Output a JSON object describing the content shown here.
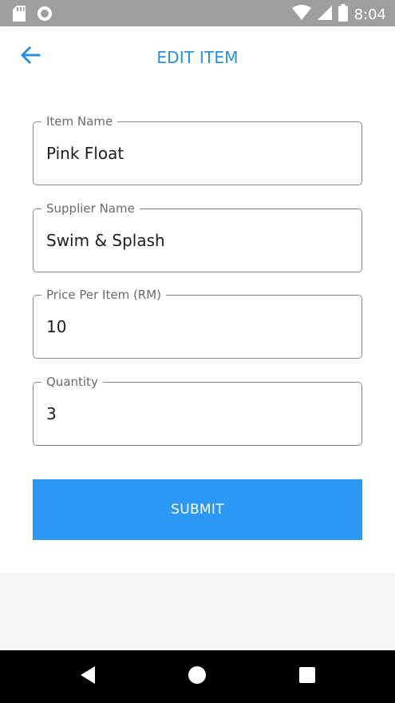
{
  "status_bar": {
    "time": "8:04",
    "icons": [
      "sd-card-icon",
      "sync-icon",
      "wifi-icon",
      "signal-icon",
      "battery-icon"
    ]
  },
  "header": {
    "title": "EDIT ITEM",
    "back_icon": "arrow-left-icon"
  },
  "form": {
    "fields": [
      {
        "label": "Item Name",
        "value": "Pink Float"
      },
      {
        "label": "Supplier Name",
        "value": "Swim & Splash"
      },
      {
        "label": "Price Per Item (RM)",
        "value": "10"
      },
      {
        "label": "Quantity",
        "value": "3"
      }
    ],
    "submit_label": "SUBMIT"
  },
  "nav_bar": {
    "icons": [
      "back-triangle-icon",
      "home-circle-icon",
      "recents-square-icon"
    ]
  },
  "colors": {
    "accent": "#2a8fe0",
    "button": "#2a98f4",
    "status_bar": "#9e9e9e",
    "nav_bar": "#000000"
  }
}
